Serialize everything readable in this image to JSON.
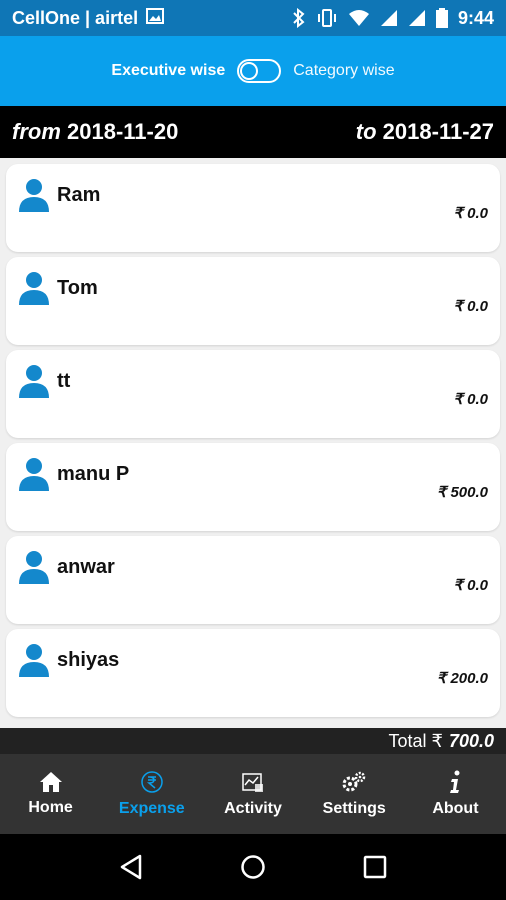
{
  "status": {
    "carrier": "CellOne | airtel",
    "time": "9:44"
  },
  "toggle": {
    "left_label": "Executive wise",
    "right_label": "Category wise"
  },
  "dates": {
    "from_keyword": "from",
    "from_date": "2018-11-20",
    "to_keyword": "to",
    "to_date": "2018-11-27"
  },
  "executives": [
    {
      "name": "Ram",
      "amount": "₹ 0.0"
    },
    {
      "name": "Tom",
      "amount": "₹ 0.0"
    },
    {
      "name": "tt",
      "amount": "₹ 0.0"
    },
    {
      "name": "manu P",
      "amount": "₹ 500.0"
    },
    {
      "name": "anwar",
      "amount": "₹ 0.0"
    },
    {
      "name": "shiyas",
      "amount": "₹ 200.0"
    }
  ],
  "total": {
    "label": "Total ₹",
    "value": "700.0"
  },
  "nav": [
    {
      "label": "Home",
      "icon": "home-icon",
      "active": false
    },
    {
      "label": "Expense",
      "icon": "rupee-icon",
      "active": true
    },
    {
      "label": "Activity",
      "icon": "activity-icon",
      "active": false
    },
    {
      "label": "Settings",
      "icon": "gears-icon",
      "active": false
    },
    {
      "label": "About",
      "icon": "info-icon",
      "active": false
    }
  ],
  "colors": {
    "status_bar": "#0f76b6",
    "top_bar": "#0aa0ec",
    "accent": "#0aa0ec",
    "person_icon": "#1488cc",
    "nav_bg": "#333333"
  }
}
